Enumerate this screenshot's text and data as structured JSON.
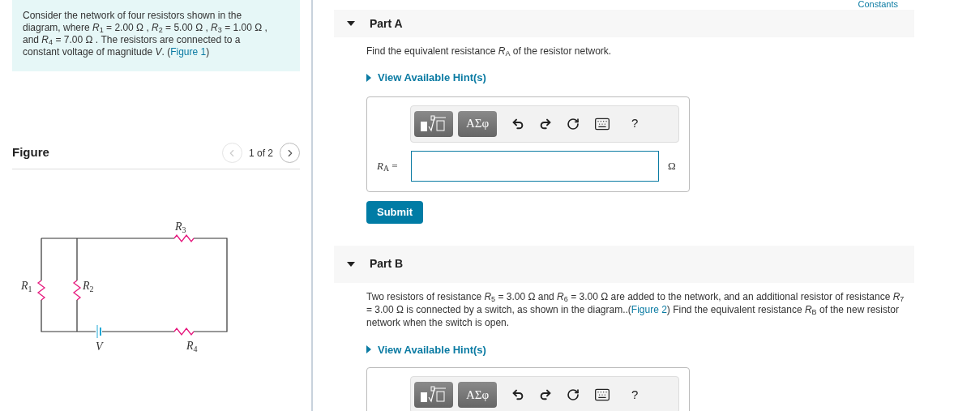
{
  "intro": {
    "before": "Consider the network of four resistors shown in the diagram, where *R*$_{1}$ = 2.00 Ω , *R*$_{2}$ = 5.00 Ω , *R*$_{3}$ = 1.00 Ω , and *R*$_{4}$ = 7.00 Ω . The resistors are connected to a constant voltage of magnitude *V*. (",
    "link": "Figure 1",
    "after": ")"
  },
  "figure": {
    "title": "Figure",
    "pager": "1 of 2",
    "prev_disabled": true,
    "labels": [
      {
        "name": "R",
        "sub": "1"
      },
      {
        "name": "R",
        "sub": "2"
      },
      {
        "name": "R",
        "sub": "3"
      },
      {
        "name": "R",
        "sub": "4"
      },
      {
        "name": "V"
      }
    ]
  },
  "constants_link": "Constants",
  "parts": [
    {
      "title": "Part A",
      "expanded": true,
      "prompt": "Find the equivalent resistance *R*$_{A}$ of the resistor network.",
      "hint": "View Available Hint(s)",
      "templates_label": "ΑΣφ",
      "help": "?",
      "answer_label": "*R*$_{A}$ =",
      "unit": "Ω",
      "submit": "Submit"
    },
    {
      "title": "Part B",
      "expanded": true,
      "prompt_before": "Two resistors of resistance *R*$_{5}$ = 3.00 Ω and *R*$_{6}$ = 3.00 Ω are added to the network, and an additional resistor of resistance *R*$_{7}$ = 3.00 Ω is connected by a switch, as shown in the diagram..(",
      "link": "Figure 2",
      "prompt_after": ") Find the equivalent resistance *R*$_{B}$ of the new resistor network when the switch is open.",
      "hint": "View Available Hint(s)",
      "templates_label": "ΑΣφ",
      "help": "?"
    }
  ]
}
